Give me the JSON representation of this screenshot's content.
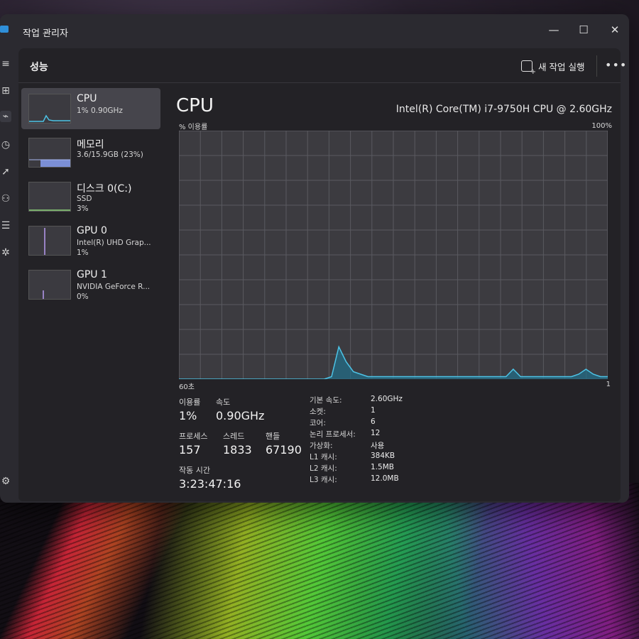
{
  "window": {
    "title": "작업 관리자",
    "minimize": "—",
    "maximize": "☐",
    "close": "✕"
  },
  "nav_icons": [
    "hamburger-icon",
    "processes-icon",
    "performance-icon",
    "history-icon",
    "startup-icon",
    "users-icon",
    "details-icon",
    "services-icon",
    "settings-icon"
  ],
  "header": {
    "title": "성능",
    "run_task": "새 작업 실행",
    "more": "•••"
  },
  "devices": [
    {
      "name": "CPU",
      "line1": "1% 0.90GHz",
      "line2": ""
    },
    {
      "name": "메모리",
      "line1": "3.6/15.9GB (23%)",
      "line2": ""
    },
    {
      "name": "디스크 0(C:)",
      "line1": "SSD",
      "line2": "3%"
    },
    {
      "name": "GPU 0",
      "line1": "Intel(R) UHD Grap...",
      "line2": "1%"
    },
    {
      "name": "GPU 1",
      "line1": "NVIDIA GeForce R...",
      "line2": "0%"
    }
  ],
  "main": {
    "title": "CPU",
    "processor": "Intel(R) Core(TM) i7-9750H CPU @ 2.60GHz",
    "util_label": "% 이용률",
    "max_label": "100%",
    "axis_left": "60초",
    "axis_right": "1"
  },
  "stats": {
    "utilization": {
      "label": "이용률",
      "value": "1%"
    },
    "speed": {
      "label": "속도",
      "value": "0.90GHz"
    },
    "processes": {
      "label": "프로세스",
      "value": "157"
    },
    "threads": {
      "label": "스레드",
      "value": "1833"
    },
    "handles": {
      "label": "핸들",
      "value": "67190"
    },
    "uptime": {
      "label": "작동 시간",
      "value": "3:23:47:16"
    }
  },
  "specs": [
    {
      "key": "기본 속도:",
      "value": "2.60GHz"
    },
    {
      "key": "소켓:",
      "value": "1"
    },
    {
      "key": "코어:",
      "value": "6"
    },
    {
      "key": "논리 프로세서:",
      "value": "12"
    },
    {
      "key": "가상화:",
      "value": "사용"
    },
    {
      "key": "L1 캐시:",
      "value": "384KB"
    },
    {
      "key": "L2 캐시:",
      "value": "1.5MB"
    },
    {
      "key": "L3 캐시:",
      "value": "12.0MB"
    }
  ],
  "chart_data": {
    "type": "area",
    "xlabel": "",
    "ylabel": "% 이용률",
    "xlim": [
      60,
      0
    ],
    "ylim": [
      0,
      100
    ],
    "grid": true,
    "series": [
      {
        "values": [
          0,
          0,
          0,
          0,
          0,
          0,
          0,
          0,
          0,
          0,
          0,
          0,
          0,
          0,
          0,
          0,
          0,
          0,
          0,
          0,
          0,
          1,
          13,
          7,
          3,
          2,
          1,
          1,
          1,
          1,
          1,
          1,
          1,
          1,
          1,
          1,
          1,
          1,
          1,
          1,
          1,
          1,
          1,
          1,
          1,
          1,
          4,
          1,
          1,
          1,
          1,
          1,
          1,
          1,
          1,
          2,
          4,
          2,
          1,
          1
        ]
      }
    ],
    "colors": {
      "line": "#4cc3e6",
      "fill": "#1f6f8a",
      "grid": "#5a5a60",
      "background": "#3c3b40"
    }
  }
}
